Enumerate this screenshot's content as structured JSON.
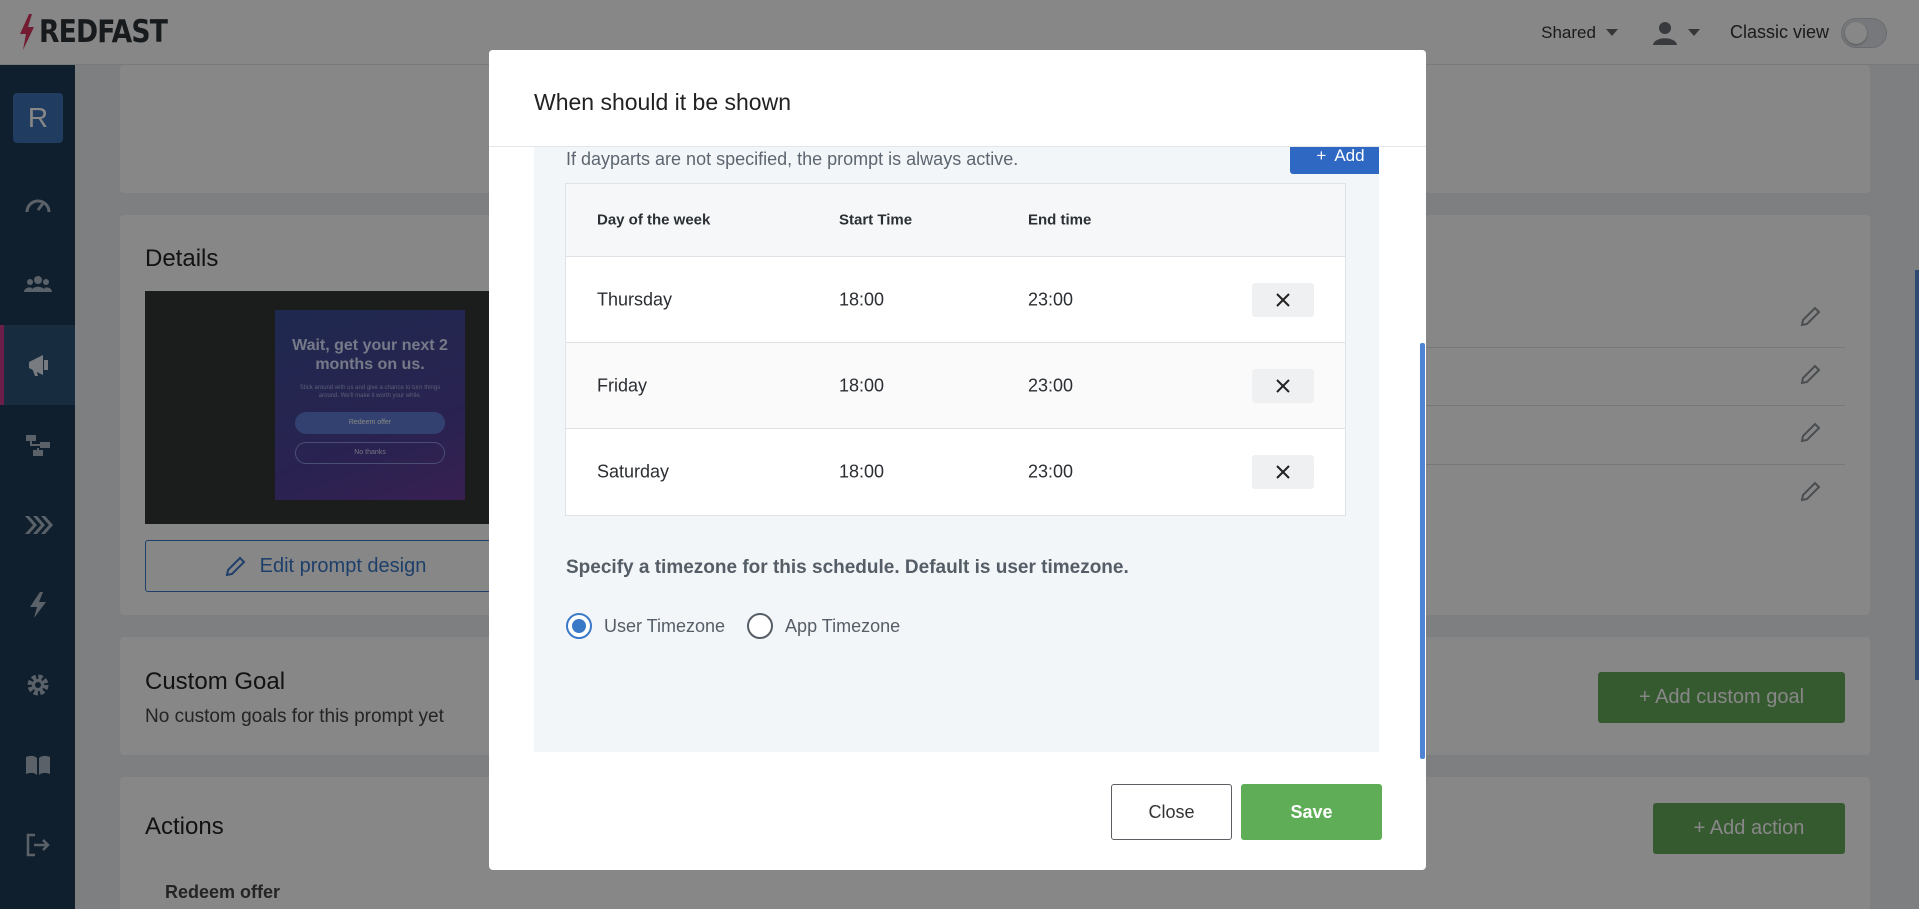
{
  "header": {
    "brand": "REDFAST",
    "shared_label": "Shared",
    "classic_view_label": "Classic view"
  },
  "sidebar": {
    "avatar_letter": "R",
    "items": [
      "dashboard-icon",
      "users-icon",
      "megaphone-icon",
      "flow-icon",
      "chevrons-icon",
      "bolt-icon",
      "gear-icon",
      "book-icon",
      "logout-icon"
    ]
  },
  "page": {
    "details_title": "Details",
    "preview": {
      "headline": "Wait, get your next 2 months on us.",
      "body": "Stick around with us and give a chance to turn things around. We'll make it worth your while.",
      "redeem": "Redeem offer",
      "no_thanks": "No thanks"
    },
    "edit_prompt_label": "Edit prompt design",
    "custom_goal_title": "Custom Goal",
    "custom_goal_empty": "No custom goals for this prompt yet",
    "add_custom_goal": "+ Add custom goal",
    "actions_title": "Actions",
    "add_action": "+ Add action",
    "redeem_offer_label": "Redeem offer"
  },
  "modal": {
    "title": "When should it be shown",
    "add_label": "Add",
    "daypart_note": "If dayparts are not specified, the prompt is always active.",
    "table": {
      "headers": [
        "Day of the week",
        "Start Time",
        "End time"
      ],
      "rows": [
        {
          "day": "Thursday",
          "start": "18:00",
          "end": "23:00"
        },
        {
          "day": "Friday",
          "start": "18:00",
          "end": "23:00"
        },
        {
          "day": "Saturday",
          "start": "18:00",
          "end": "23:00"
        }
      ]
    },
    "timezone_title": "Specify a timezone for this schedule. Default is user timezone.",
    "timezone_options": [
      "User Timezone",
      "App Timezone"
    ],
    "timezone_selected": "User Timezone",
    "close_label": "Close",
    "save_label": "Save"
  },
  "colors": {
    "primary": "#3a78c8",
    "success": "#5fad56",
    "sidebar": "#1f3c55",
    "brand_accent": "#c83a8a"
  }
}
